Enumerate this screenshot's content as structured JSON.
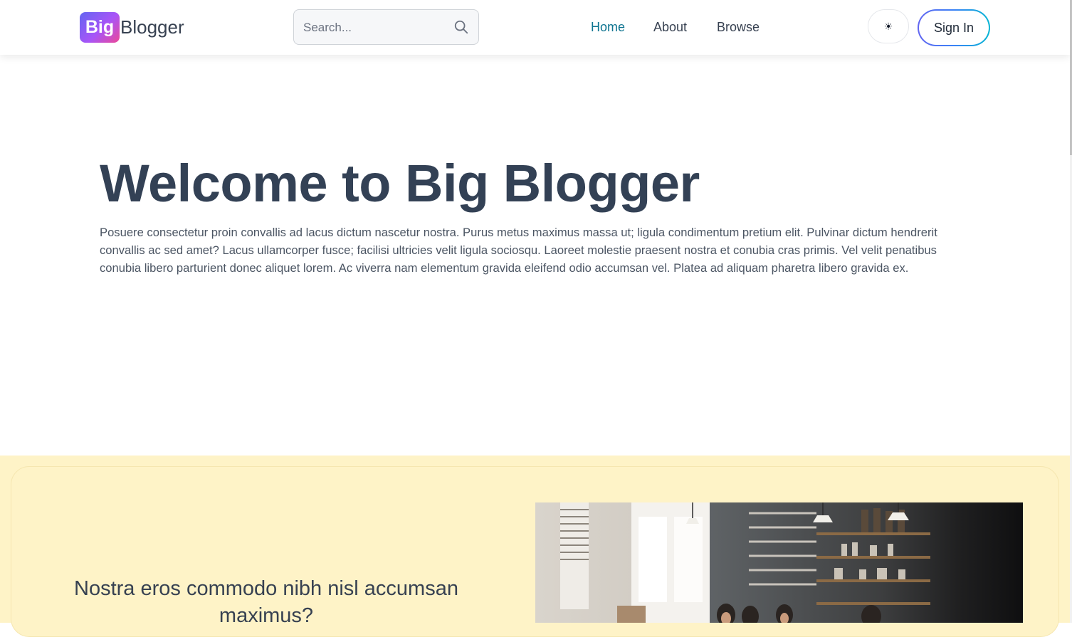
{
  "header": {
    "logo": {
      "badge": "Big",
      "text": "Blogger"
    },
    "search": {
      "placeholder": "Search...",
      "icon": "search-icon"
    },
    "nav": [
      {
        "label": "Home",
        "active": true
      },
      {
        "label": "About",
        "active": false
      },
      {
        "label": "Browse",
        "active": false
      }
    ],
    "theme_toggle": {
      "icon": "sun-icon"
    },
    "sign_in_label": "Sign In"
  },
  "hero": {
    "title": "Welcome to Big Blogger",
    "text": "Posuere consectetur proin convallis ad lacus dictum nascetur nostra. Purus metus maximus massa ut; ligula condimentum pretium elit. Pulvinar dictum hendrerit convallis ac sed amet? Lacus ullamcorper fusce; facilisi ultricies velit ligula sociosqu. Laoreet molestie praesent nostra et conubia cras primis. Vel velit penatibus conubia libero parturient donec aliquet lorem. Ac viverra nam elementum gravida eleifend odio accumsan vel. Platea ad aliquam pharetra libero gravida ex."
  },
  "feature": {
    "heading": "Nostra eros commodo nibh nisl accumsan maximus?",
    "image": "cafe-photo"
  },
  "colors": {
    "accent": "#0e7490",
    "heading": "#334155",
    "feature_bg": "#fef3c7",
    "logo_gradient": [
      "#6366f1",
      "#a855f7",
      "#ec4899"
    ],
    "signin_gradient": [
      "#6366f1",
      "#3b82f6",
      "#06b6d4"
    ]
  }
}
